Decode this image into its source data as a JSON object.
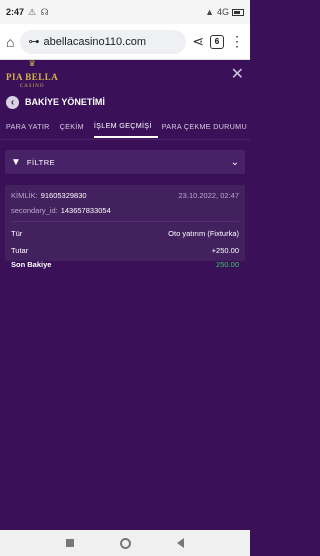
{
  "status": {
    "time": "2:47",
    "notification_icons": "⚠ ☊",
    "network": "4G",
    "battery_icon": "battery-icon"
  },
  "browser": {
    "url": "abellacasino110.com",
    "tab_count": "6"
  },
  "site": {
    "logo_name": "PIA BELLA",
    "logo_sub": "CASINO"
  },
  "page": {
    "title": "BAKİYE YÖNETİMİ"
  },
  "tabs": [
    {
      "label": "PARA YATIR"
    },
    {
      "label": "ÇEKİM"
    },
    {
      "label": "İŞLEM GEÇMİŞİ"
    },
    {
      "label": "PARA ÇEKME DURUMU"
    }
  ],
  "filter": {
    "label": "FİLTRE"
  },
  "record": {
    "id_label": "KİMLİK:",
    "id_value": "91605329830",
    "date": "23.10.2022, 02:47",
    "secondary_label": "secondary_id:",
    "secondary_value": "143657833054",
    "type_label": "Tür",
    "type_value": "Oto yatırım (Fixturka)",
    "amount_label": "Tutar",
    "amount_value": "+250.00",
    "balance_label": "Son Bakiye",
    "balance_value": "250.00"
  },
  "colors": {
    "background": "#3a1158",
    "card": "#43205e",
    "accent_gold": "#d7b24a",
    "positive_green": "#38c46a"
  }
}
